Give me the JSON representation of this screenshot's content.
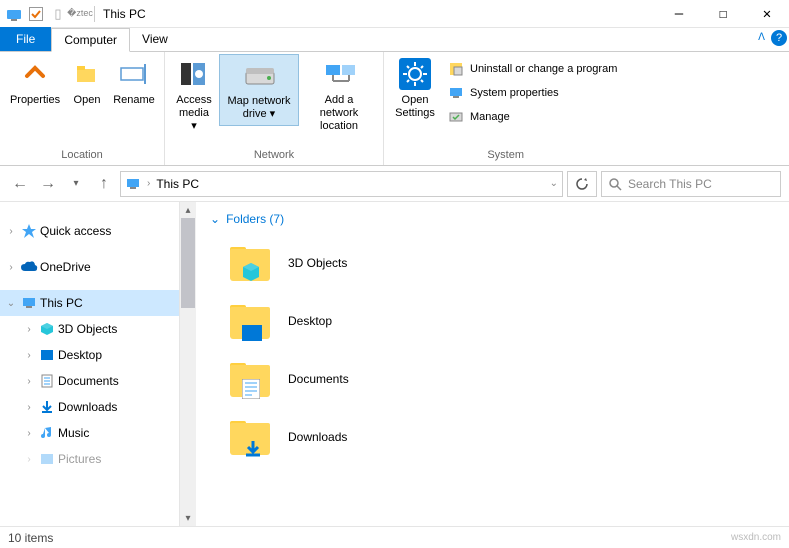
{
  "window": {
    "title": "This PC",
    "minimize": "—",
    "maximize": "☐",
    "close": "✕"
  },
  "tabs": {
    "file": "File",
    "computer": "Computer",
    "view": "View"
  },
  "ribbon": {
    "location": {
      "label": "Location",
      "properties": "Properties",
      "open": "Open",
      "rename": "Rename"
    },
    "network": {
      "label": "Network",
      "access_media": "Access media ▾",
      "map_drive": "Map network drive ▾",
      "add_location": "Add a network location"
    },
    "system": {
      "label": "System",
      "open_settings": "Open Settings",
      "uninstall": "Uninstall or change a program",
      "properties": "System properties",
      "manage": "Manage"
    }
  },
  "nav": {
    "path": "This PC",
    "search_placeholder": "Search This PC"
  },
  "tree": {
    "quick_access": "Quick access",
    "onedrive": "OneDrive",
    "this_pc": "This PC",
    "objects_3d": "3D Objects",
    "desktop": "Desktop",
    "documents": "Documents",
    "downloads": "Downloads",
    "music": "Music",
    "pictures": "Pictures"
  },
  "content": {
    "section": "Folders (7)",
    "items": {
      "objects_3d": "3D Objects",
      "desktop": "Desktop",
      "documents": "Documents",
      "downloads": "Downloads"
    }
  },
  "status": {
    "items": "10 items",
    "watermark": "wsxdn.com"
  }
}
